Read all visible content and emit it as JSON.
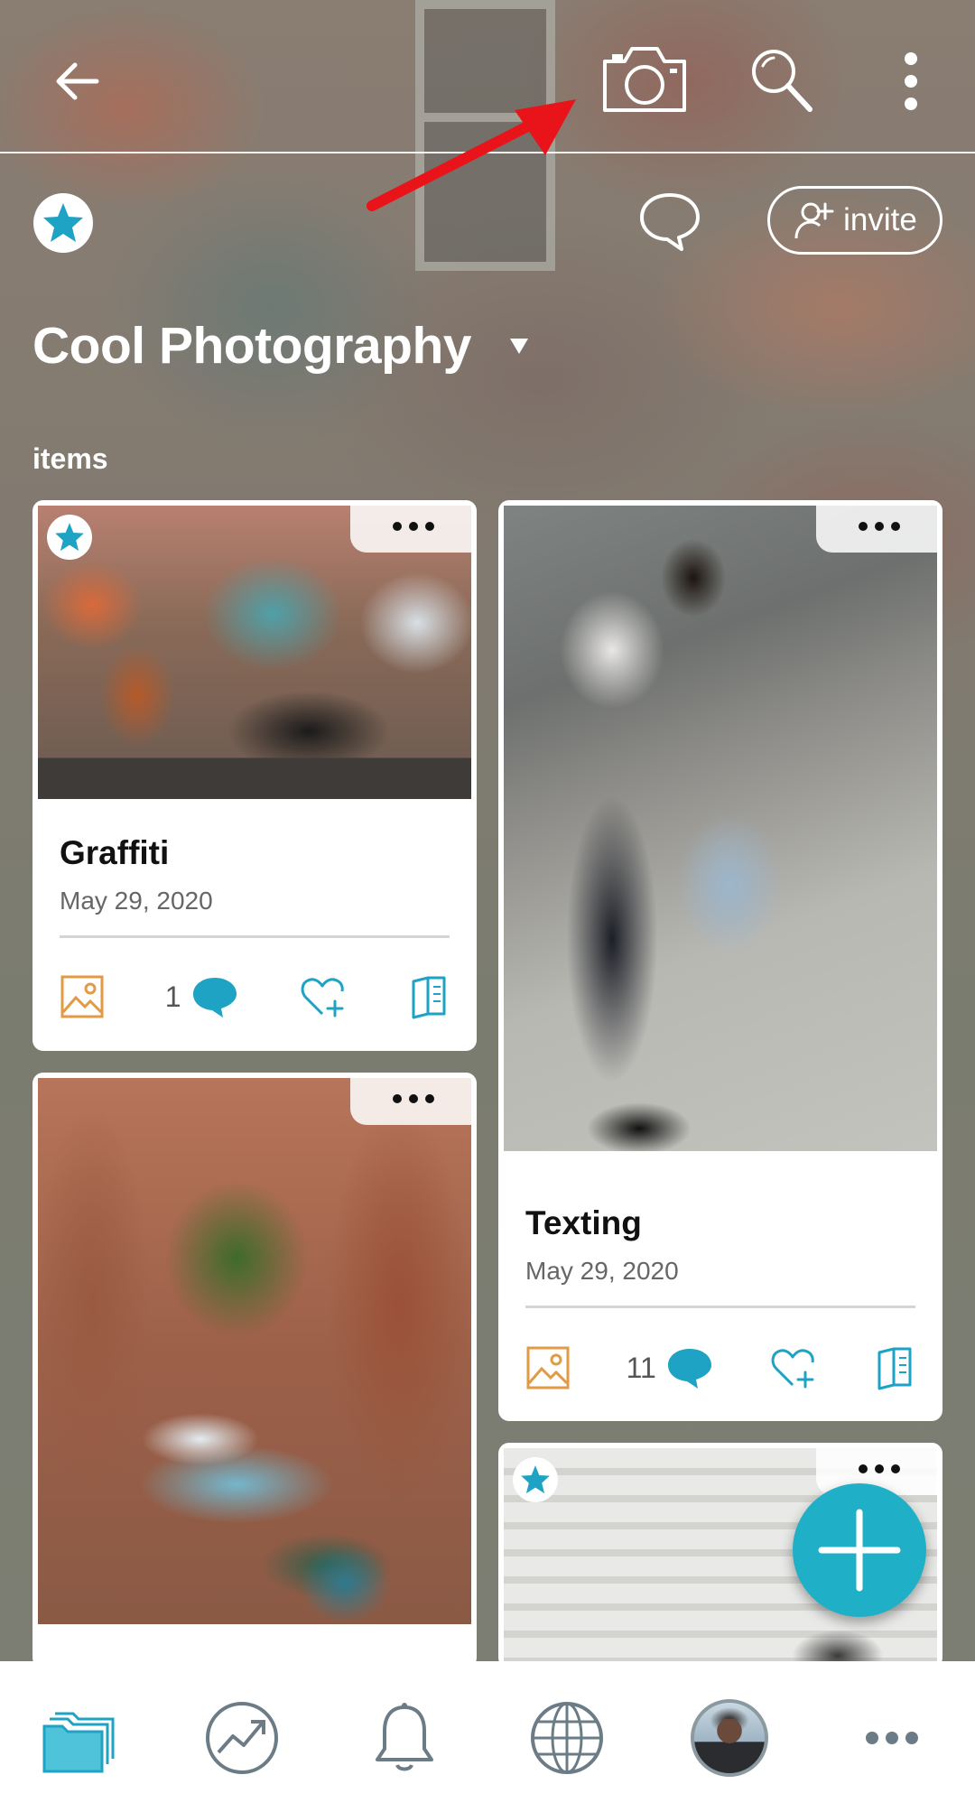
{
  "board": {
    "title": "Cool Photography",
    "section_label": "items",
    "invite_label": "invite"
  },
  "cards": [
    {
      "name": "Graffiti",
      "date": "May 29, 2020",
      "comment_count": "1",
      "starred": true
    },
    {
      "name": "Texting",
      "date": "May 29, 2020",
      "comment_count": "11",
      "starred": false
    },
    {
      "name": "",
      "date": "",
      "starred": false
    },
    {
      "name": "",
      "date": "",
      "starred": true
    }
  ],
  "icons": {
    "back": "arrow-left-icon",
    "camera": "camera-icon",
    "search": "search-icon",
    "more": "more-vertical-icon",
    "chat": "chat-bubble-icon",
    "invite": "add-person-icon",
    "image": "image-icon",
    "comment": "comment-icon",
    "like": "heart-plus-icon",
    "book": "book-icon",
    "fab": "plus-icon",
    "nav": [
      "folders-icon",
      "trending-icon",
      "bell-icon",
      "globe-icon",
      "avatar",
      "more-horizontal-icon"
    ]
  },
  "colors": {
    "accent": "#1fb0c8",
    "image_icon": "#e39a45",
    "annotation_arrow": "#e8141a"
  }
}
